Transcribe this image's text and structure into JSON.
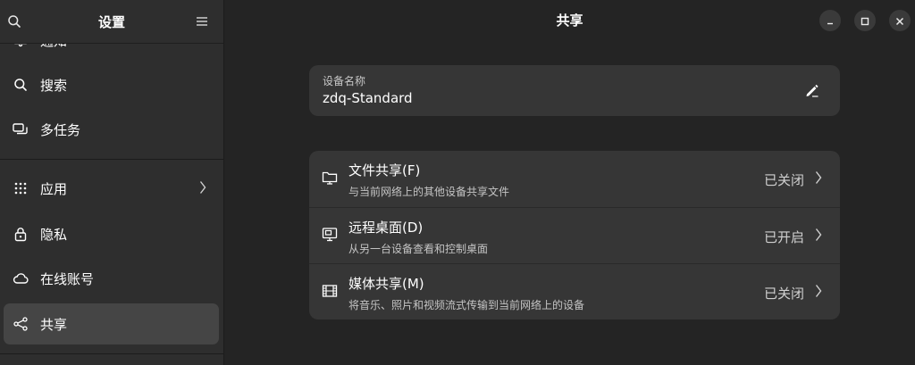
{
  "sidebar": {
    "title": "设置",
    "search_icon": "search-icon",
    "menu_icon": "hamburger-menu-icon",
    "items": [
      {
        "label": "通知",
        "icon": "bell-icon"
      },
      {
        "label": "搜索",
        "icon": "search-icon"
      },
      {
        "label": "多任务",
        "icon": "multitasking-icon"
      },
      {
        "label": "应用",
        "icon": "apps-grid-icon",
        "has_chevron": true
      },
      {
        "label": "隐私",
        "icon": "lock-icon"
      },
      {
        "label": "在线账号",
        "icon": "cloud-icon"
      },
      {
        "label": "共享",
        "icon": "share-icon",
        "active": true
      }
    ]
  },
  "main": {
    "title": "共享",
    "device_name": {
      "label": "设备名称",
      "value": "zdq-Standard",
      "edit_icon": "edit-pencil-icon"
    },
    "sharing_items": [
      {
        "title": "文件共享(F)",
        "subtitle": "与当前网络上的其他设备共享文件",
        "status": "已关闭",
        "icon": "folder-share-icon"
      },
      {
        "title": "远程桌面(D)",
        "subtitle": "从另一台设备查看和控制桌面",
        "status": "已开启",
        "icon": "remote-desktop-icon"
      },
      {
        "title": "媒体共享(M)",
        "subtitle": "将音乐、照片和视频流式传输到当前网络上的设备",
        "status": "已关闭",
        "icon": "film-icon"
      }
    ]
  },
  "window_controls": {
    "minimize_icon": "minimize-icon",
    "maximize_icon": "maximize-icon",
    "close_icon": "close-icon"
  },
  "colors": {
    "sidebar_bg": "#2e2e2e",
    "main_bg": "#242424",
    "card_bg": "#363636",
    "active_item_bg": "#454545"
  }
}
